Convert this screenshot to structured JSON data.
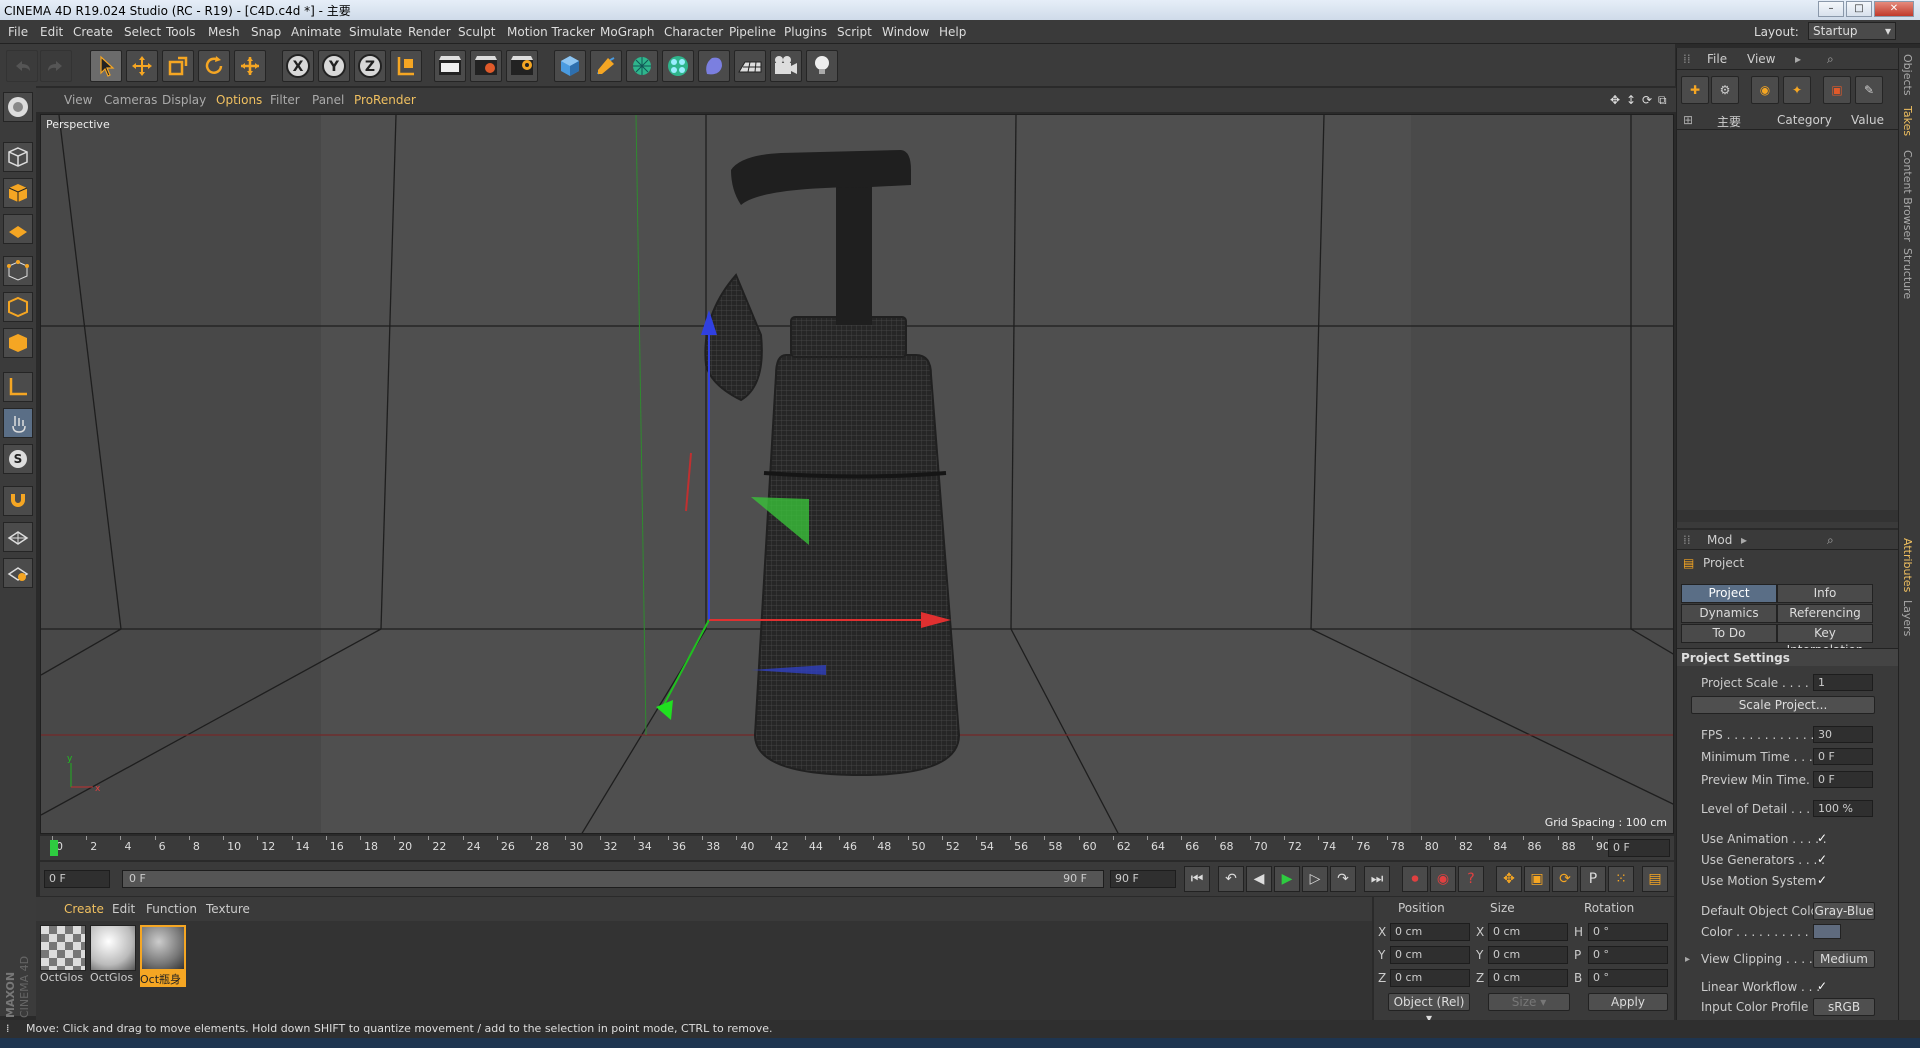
{
  "app": {
    "title": "CINEMA 4D R19.024 Studio (RC - R19) - [C4D.c4d *] - 主要",
    "layout_label": "Layout:",
    "layout_value": "Startup"
  },
  "menu": [
    "File",
    "Edit",
    "Create",
    "Select",
    "Tools",
    "Mesh",
    "Snap",
    "Animate",
    "Simulate",
    "Render",
    "Sculpt",
    "Motion Tracker",
    "MoGraph",
    "Character",
    "Pipeline",
    "Plugins",
    "Script",
    "Window",
    "Help"
  ],
  "toolbar": {
    "icons": [
      "undo-icon",
      "redo-icon",
      "select-arrow-icon",
      "move-icon",
      "scale-icon",
      "rotate-icon",
      "live-select-icon",
      "x-axis-icon",
      "y-axis-icon",
      "z-axis-icon",
      "coordinate-system-icon",
      "render-view-icon",
      "render-picture-viewer-icon",
      "edit-render-settings-icon",
      "cube-icon",
      "pen-icon",
      "subdivision-icon",
      "cloner-icon",
      "deformer-icon",
      "floor-icon",
      "camera-icon",
      "light-icon"
    ],
    "axis_labels": [
      "X",
      "Y",
      "Z"
    ]
  },
  "viewport": {
    "menu": [
      "View",
      "Cameras",
      "Display",
      "Options",
      "Filter",
      "Panel",
      "ProRender"
    ],
    "camera": "Perspective",
    "grid_spacing": "Grid Spacing : 100 cm",
    "axis_y": "y",
    "axis_x": "x"
  },
  "timeline": {
    "ticks": [
      "0",
      "2",
      "4",
      "6",
      "8",
      "10",
      "12",
      "14",
      "16",
      "18",
      "20",
      "22",
      "24",
      "26",
      "28",
      "30",
      "32",
      "34",
      "36",
      "38",
      "40",
      "42",
      "44",
      "46",
      "48",
      "50",
      "52",
      "54",
      "56",
      "58",
      "60",
      "62",
      "64",
      "66",
      "68",
      "70",
      "72",
      "74",
      "76",
      "78",
      "80",
      "82",
      "84",
      "86",
      "88",
      "90"
    ],
    "current_frame": "0 F"
  },
  "controls": {
    "start_field": "0 F",
    "range_start": "0 F",
    "range_end": "90 F",
    "end_field": "90 F"
  },
  "materials": {
    "menu": [
      "Create",
      "Edit",
      "Function",
      "Texture"
    ],
    "items": [
      {
        "name": "OctGlos",
        "style": "checker"
      },
      {
        "name": "OctGlos",
        "style": "white"
      },
      {
        "name": "Oct瓶身",
        "style": "gray"
      }
    ]
  },
  "coordinates": {
    "headers": [
      "Position",
      "Size",
      "Rotation"
    ],
    "rows": [
      {
        "a": "X",
        "pos": "0 cm",
        "b": "X",
        "size": "0 cm",
        "c": "H",
        "rot": "0 °"
      },
      {
        "a": "Y",
        "pos": "0 cm",
        "b": "Y",
        "size": "0 cm",
        "c": "P",
        "rot": "0 °"
      },
      {
        "a": "Z",
        "pos": "0 cm",
        "b": "Z",
        "size": "0 cm",
        "c": "B",
        "rot": "0 °"
      }
    ],
    "mode": "Object (Rel)",
    "size_mode": "Size",
    "apply": "Apply"
  },
  "status": "Move: Click and drag to move elements. Hold down SHIFT to quantize movement / add to the selection in point mode, CTRL to remove.",
  "objects": {
    "menu": [
      "File",
      "View"
    ],
    "columns": [
      "主要",
      "Category",
      "Value"
    ]
  },
  "attributes": {
    "mode": "Mod",
    "title": "Project",
    "tabs": [
      "Project Settings",
      "Info",
      "Dynamics",
      "Referencing",
      "To Do",
      "Key Interpolation"
    ],
    "section": "Project Settings",
    "rows": {
      "project_scale": {
        "label": "Project Scale . . . . . .",
        "value": "1"
      },
      "scale_project": "Scale Project...",
      "fps": {
        "label": "FPS . . . . . . . . . . . . .",
        "value": "30"
      },
      "min_time": {
        "label": "Minimum Time . . . . .",
        "value": "0 F"
      },
      "preview_min": {
        "label": "Preview Min Time. . .",
        "value": "0 F"
      },
      "lod": {
        "label": "Level of Detail . . . . .",
        "value": "100 %"
      },
      "use_animation": "Use Animation . . . . .",
      "use_generators": "Use Generators . . . .",
      "use_motion": "Use Motion System",
      "default_color": {
        "label": "Default Object Color",
        "value": "Gray-Blue"
      },
      "color": "Color . . . . . . . . . .",
      "view_clipping": {
        "label": "View Clipping . . . . .",
        "value": "Medium"
      },
      "linear_workflow": "Linear Workflow . . .",
      "input_profile": {
        "label": "Input Color Profile",
        "value": "sRGB"
      }
    },
    "check": "✓"
  },
  "right_tabs": [
    "Objects",
    "Takes",
    "Content Browser",
    "Structure",
    "Attributes",
    "Layers"
  ],
  "colors": {
    "accent": "#f5a623",
    "selected_tab": "#5a6e86",
    "grid": "#1e1e1e"
  }
}
